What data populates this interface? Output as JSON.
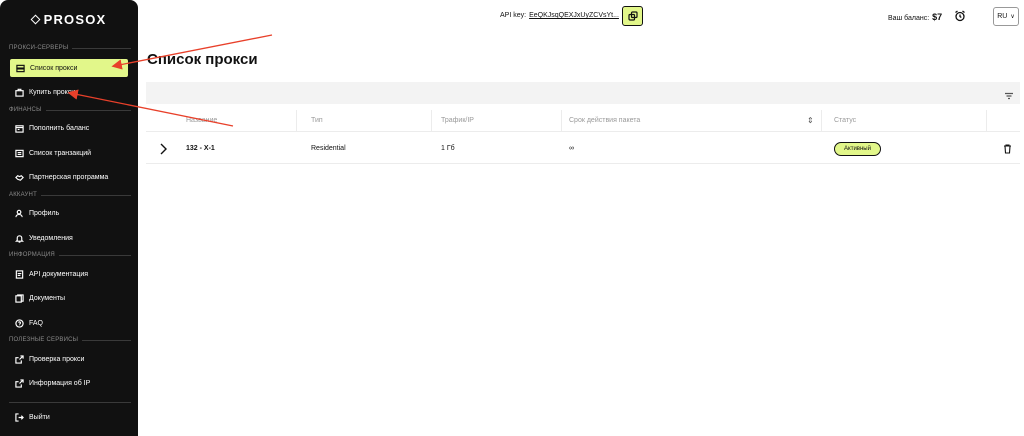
{
  "brand": {
    "logo_text": "PROSOX"
  },
  "sidebar": {
    "sections": [
      {
        "title": "ПРОКСИ-СЕРВЕРЫ"
      },
      {
        "title": "ФИНАНСЫ"
      },
      {
        "title": "АККАУНТ"
      },
      {
        "title": "ИНФОРМАЦИЯ"
      },
      {
        "title": "ПОЛЕЗНЫЕ СЕРВИСЫ"
      }
    ],
    "items": [
      {
        "label": "Список прокси",
        "icon": "server-icon",
        "active": true
      },
      {
        "label": "Купить прокси",
        "icon": "bag-icon"
      },
      {
        "label": "Пополнить баланс",
        "icon": "wallet-icon"
      },
      {
        "label": "Список транзакций",
        "icon": "list-icon"
      },
      {
        "label": "Партнерская программа",
        "icon": "handshake-icon"
      },
      {
        "label": "Профиль",
        "icon": "user-icon"
      },
      {
        "label": "Уведомления",
        "icon": "bell-icon"
      },
      {
        "label": "API документация",
        "icon": "doc-icon"
      },
      {
        "label": "Документы",
        "icon": "files-icon"
      },
      {
        "label": "FAQ",
        "icon": "question-icon"
      },
      {
        "label": "Проверка прокси",
        "icon": "external-link-icon"
      },
      {
        "label": "Информация об IP",
        "icon": "external-link-icon"
      }
    ],
    "logout_label": "Выйти"
  },
  "header": {
    "api_key_label": "API key:",
    "api_key_value": "EeQKJsqQEXJxUyZCVsYt...",
    "balance_label": "Ваш баланс:",
    "balance_value": "$7",
    "language": "RU"
  },
  "main": {
    "title": "Список прокси",
    "columns": [
      "Название",
      "Тип",
      "Трафик/IP",
      "Срок действия пакета",
      "Статус"
    ],
    "rows": [
      {
        "name": "132 - X-1",
        "type": "Residential",
        "traffic": "1 Гб",
        "expiry": "∞",
        "status": "Активный"
      }
    ]
  },
  "colors": {
    "accent": "#e2f78a",
    "sidebar_bg": "#111111",
    "annotation": "#e8402a"
  }
}
